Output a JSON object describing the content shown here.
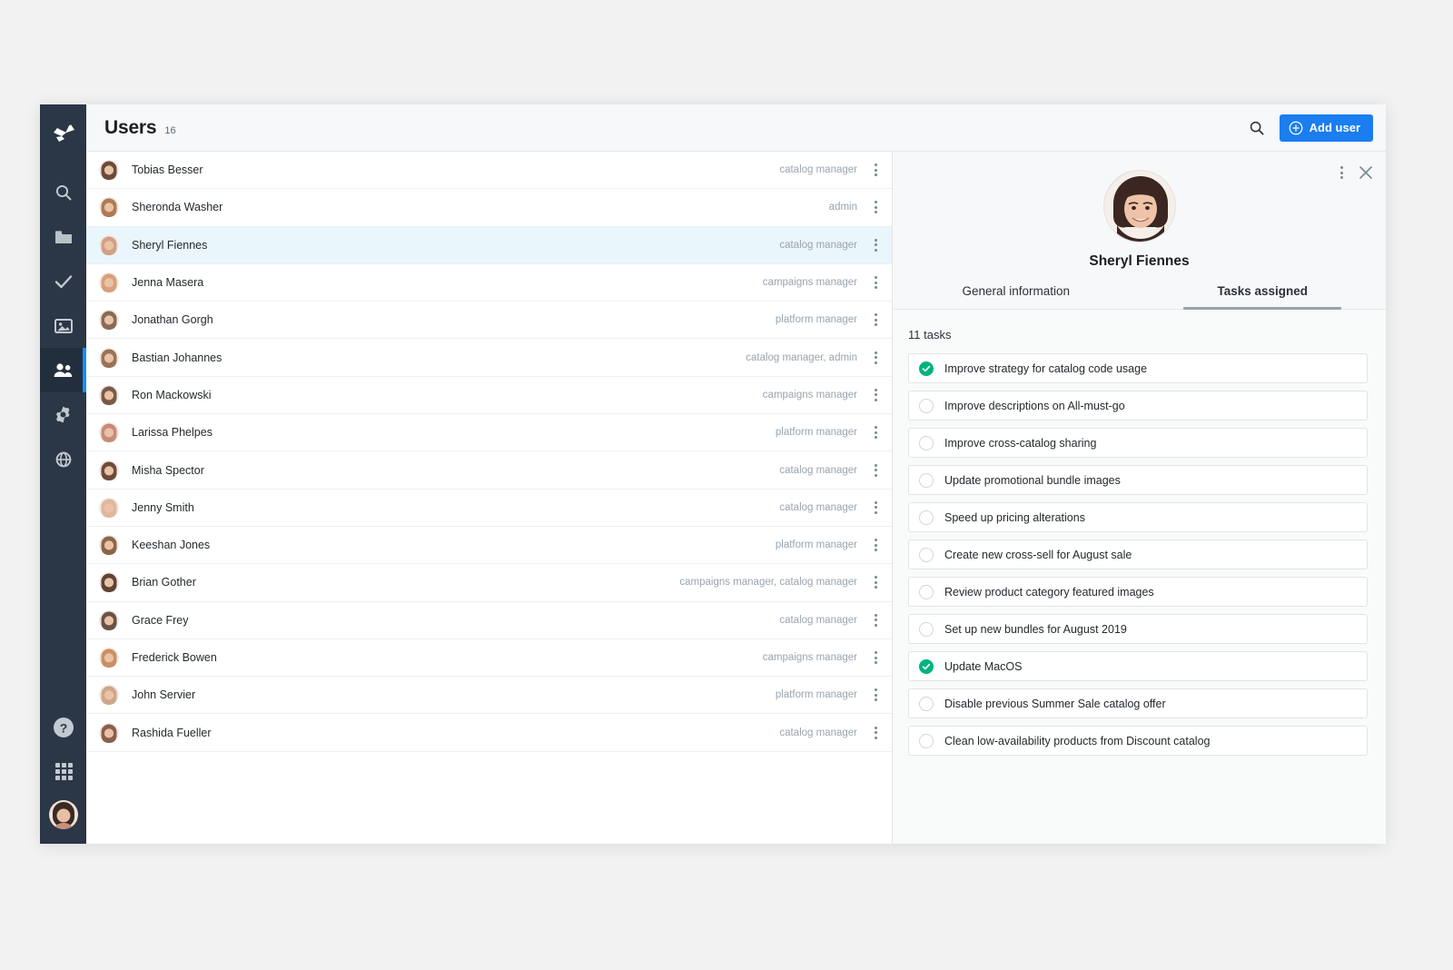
{
  "sidebar": {
    "logo": "app-logo",
    "items": [
      {
        "name": "search",
        "icon": "search-icon",
        "active": false
      },
      {
        "name": "folder",
        "icon": "folder-icon",
        "active": false
      },
      {
        "name": "tasks",
        "icon": "check-icon",
        "active": false
      },
      {
        "name": "media",
        "icon": "image-icon",
        "active": false
      },
      {
        "name": "users",
        "icon": "users-icon",
        "active": true
      },
      {
        "name": "settings",
        "icon": "gear-icon",
        "active": false
      },
      {
        "name": "globe",
        "icon": "globe-icon",
        "active": false
      }
    ],
    "bottom": [
      {
        "name": "help",
        "icon": "question-circle-icon"
      },
      {
        "name": "apps",
        "icon": "grid-apps-icon"
      },
      {
        "name": "account",
        "icon": "user-avatar"
      }
    ]
  },
  "header": {
    "title": "Users",
    "count": "16",
    "search_icon": "search-icon",
    "add_user_label": "Add user",
    "add_user_icon": "plus-circle-icon",
    "accent_color": "#1a7df0"
  },
  "users": [
    {
      "name": "Tobias Besser",
      "role": "catalog manager",
      "selected": false,
      "avatar": "#6b4a3a"
    },
    {
      "name": "Sheronda Washer",
      "role": "admin",
      "selected": false,
      "avatar": "#b07a52"
    },
    {
      "name": "Sheryl Fiennes",
      "role": "catalog manager",
      "selected": true,
      "avatar": "#d39f86"
    },
    {
      "name": "Jenna Masera",
      "role": "campaigns manager",
      "selected": false,
      "avatar": "#d8a07c"
    },
    {
      "name": "Jonathan Gorgh",
      "role": "platform manager",
      "selected": false,
      "avatar": "#8a6a55"
    },
    {
      "name": "Bastian Johannes",
      "role": "catalog manager, admin",
      "selected": false,
      "avatar": "#9a7356"
    },
    {
      "name": "Ron Mackowski",
      "role": "campaigns manager",
      "selected": false,
      "avatar": "#7a5a46"
    },
    {
      "name": "Larissa Phelpes",
      "role": "platform manager",
      "selected": false,
      "avatar": "#c98a7a"
    },
    {
      "name": "Misha Spector",
      "role": "catalog manager",
      "selected": false,
      "avatar": "#6d4b3c"
    },
    {
      "name": "Jenny Smith",
      "role": "catalog manager",
      "selected": false,
      "avatar": "#e0b79c"
    },
    {
      "name": "Keeshan Jones",
      "role": "platform manager",
      "selected": false,
      "avatar": "#8c6549"
    },
    {
      "name": "Brian Gother",
      "role": "campaigns manager, catalog manager",
      "selected": false,
      "avatar": "#5f4334"
    },
    {
      "name": "Grace Frey",
      "role": "catalog manager",
      "selected": false,
      "avatar": "#6b5244"
    },
    {
      "name": "Frederick Bowen",
      "role": "campaigns manager",
      "selected": false,
      "avatar": "#c98f63"
    },
    {
      "name": "John Servier",
      "role": "platform manager",
      "selected": false,
      "avatar": "#cfa688"
    },
    {
      "name": "Rashida Fueller",
      "role": "catalog manager",
      "selected": false,
      "avatar": "#8a5f4a"
    }
  ],
  "detail": {
    "kebab_icon": "more-vertical-icon",
    "close_icon": "close-icon",
    "avatar": "sheryl-fiennes-avatar",
    "name": "Sheryl Fiennes",
    "tabs": [
      {
        "label": "General information",
        "active": false
      },
      {
        "label": "Tasks assigned",
        "active": true
      }
    ],
    "task_count_label": "11 tasks",
    "done_color": "#00b37e",
    "tasks": [
      {
        "label": "Improve strategy for catalog code usage",
        "done": true
      },
      {
        "label": "Improve descriptions on All-must-go",
        "done": false
      },
      {
        "label": "Improve cross-catalog sharing",
        "done": false
      },
      {
        "label": "Update promotional bundle images",
        "done": false
      },
      {
        "label": "Speed up pricing alterations",
        "done": false
      },
      {
        "label": "Create new cross-sell for August sale",
        "done": false
      },
      {
        "label": "Review product category featured images",
        "done": false
      },
      {
        "label": "Set up new bundles for August 2019",
        "done": false
      },
      {
        "label": "Update MacOS",
        "done": true
      },
      {
        "label": "Disable previous Summer Sale catalog offer",
        "done": false
      },
      {
        "label": "Clean low-availability products from Discount catalog",
        "done": false
      }
    ]
  }
}
